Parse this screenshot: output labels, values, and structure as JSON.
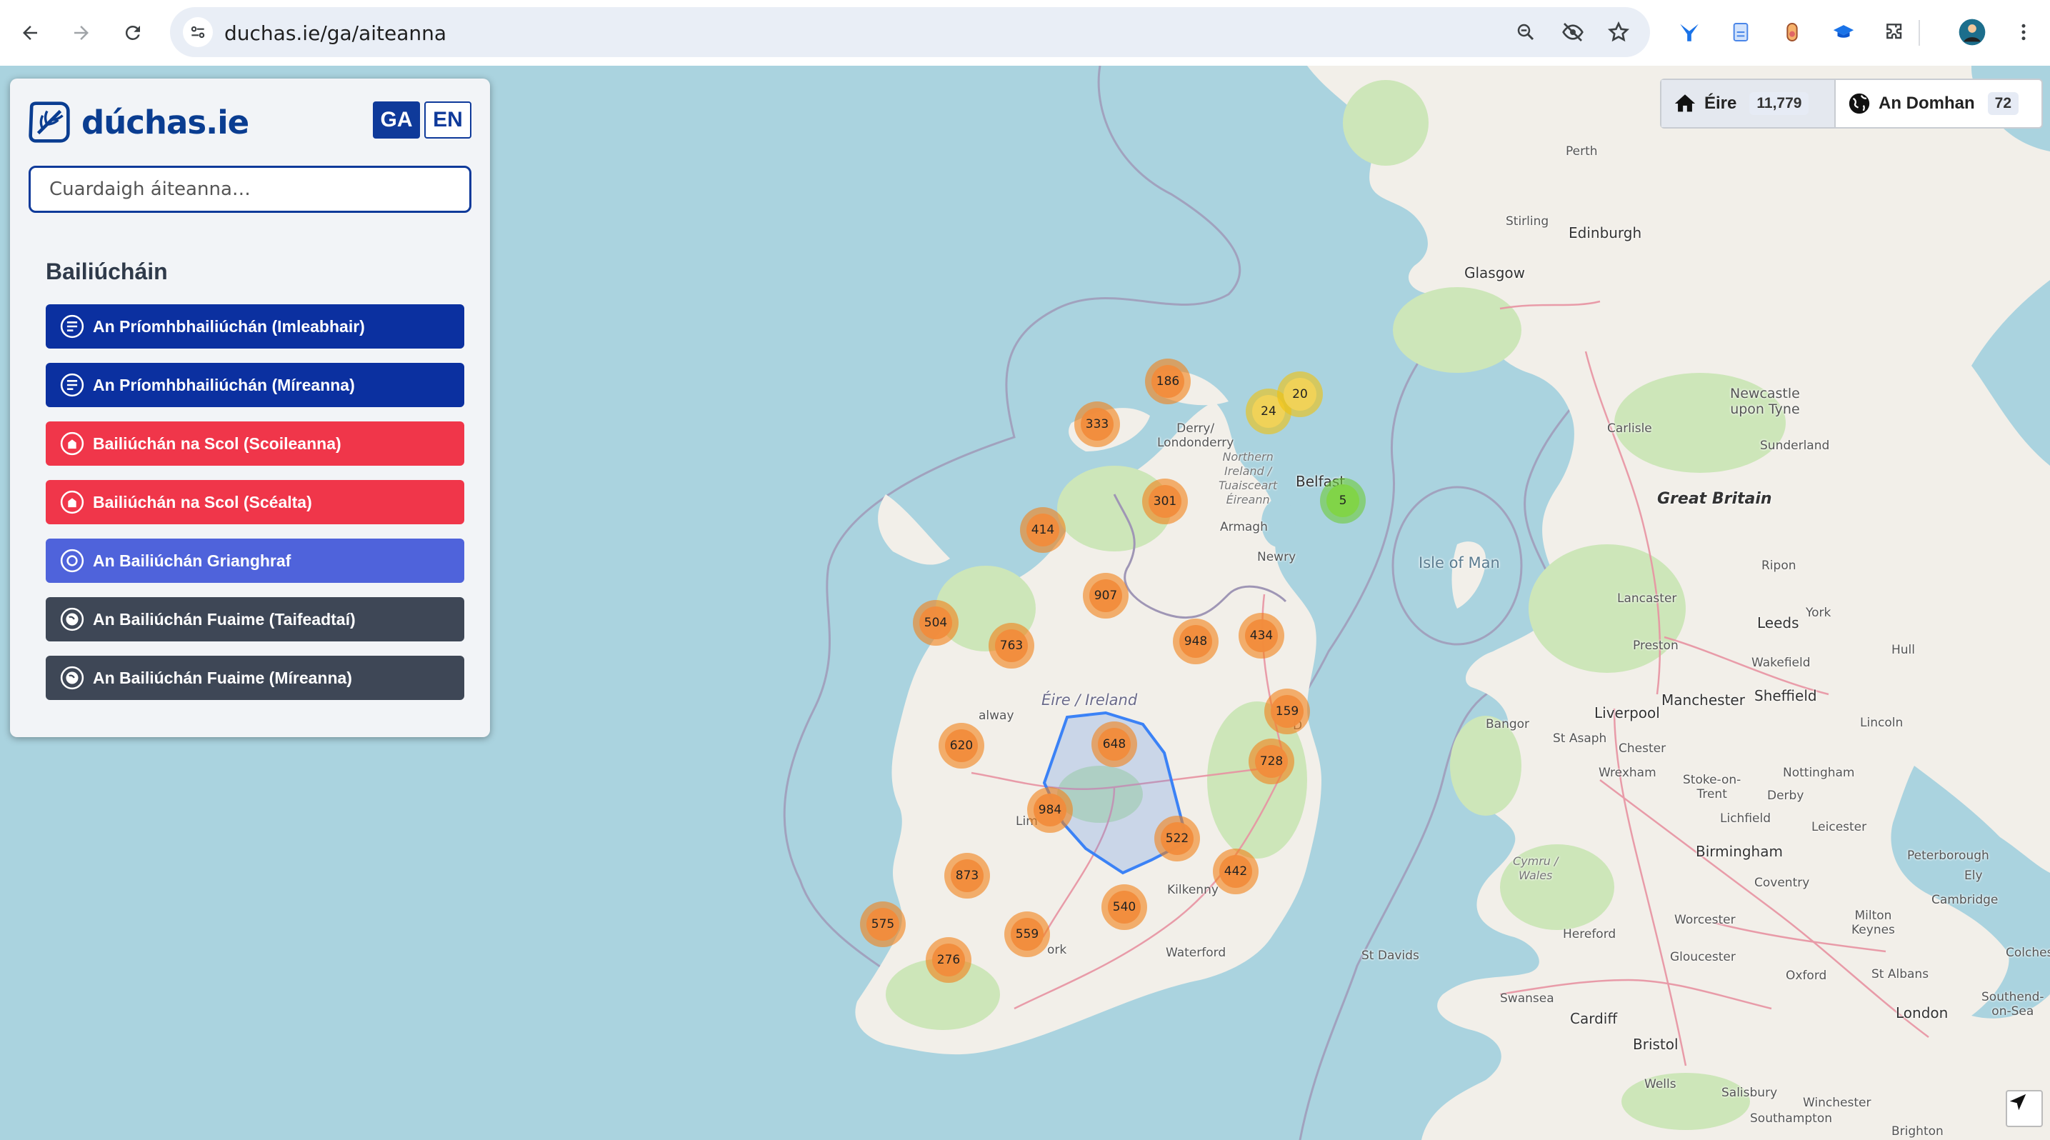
{
  "browser": {
    "url": "duchas.ie/ga/aiteanna",
    "icons": [
      "back-arrow-icon",
      "forward-arrow-icon",
      "reload-icon",
      "site-settings-icon",
      "zoom-icon",
      "eye-off-icon",
      "star-icon",
      "extension-y-icon",
      "extension-doc-icon",
      "extension-flask-icon",
      "extension-cap-icon",
      "puzzle-icon",
      "profile-avatar",
      "more-vert-icon"
    ]
  },
  "sidebar": {
    "brand": "dúchas.ie",
    "lang_ga": "GA",
    "lang_en": "EN",
    "search_placeholder": "Cuardaigh áiteanna…",
    "section_title": "Bailiúcháin",
    "collections": [
      {
        "label": "An Príomhbhailiúchán (Imleabhair)",
        "color": "#0b30a0",
        "icon": "document-lines-icon"
      },
      {
        "label": "An Príomhbhailiúchán (Míreanna)",
        "color": "#0b30a0",
        "icon": "document-lines-icon"
      },
      {
        "label": "Bailiúchán na Scol (Scoileanna)",
        "color": "#f0364a",
        "icon": "school-icon"
      },
      {
        "label": "Bailiúchán na Scol (Scéalta)",
        "color": "#f0364a",
        "icon": "school-icon"
      },
      {
        "label": "An Bailiúchán Grianghraf",
        "color": "#4f63db",
        "icon": "camera-lens-icon"
      },
      {
        "label": "An Bailiúchán Fuaime (Taifeadtaí)",
        "color": "#3e4756",
        "icon": "audio-globe-icon"
      },
      {
        "label": "An Bailiúchán Fuaime (Míreanna)",
        "color": "#3e4756",
        "icon": "audio-globe-icon"
      }
    ]
  },
  "switcher": {
    "eire_label": "Éire",
    "eire_count": "11,779",
    "world_label": "An Domhan",
    "world_count": "72"
  },
  "map": {
    "places": {
      "perth": "Perth",
      "stirling": "Stirling",
      "edinburgh": "Edinburgh",
      "glasgow": "Glasgow",
      "derry": "Derry/\nLondonderry",
      "ni": "Northern\nIreland /\nTuaisceart\nÉireann",
      "belfast": "Belfast",
      "armagh": "Armagh",
      "newry": "Newry",
      "isle_of_man": "Isle of Man",
      "newcastle": "Newcastle\nupon Tyne",
      "carlisle": "Carlisle",
      "sunderland": "Sunderland",
      "great_britain": "Great Britain",
      "ripon": "Ripon",
      "lancaster": "Lancaster",
      "york": "York",
      "leeds": "Leeds",
      "preston": "Preston",
      "hull": "Hull",
      "wakefield": "Wakefield",
      "manchester": "Manchester",
      "sheffield": "Sheffield",
      "liverpool": "Liverpool",
      "bangor": "Bangor",
      "st_asaph": "St Asaph",
      "chester": "Chester",
      "lincoln": "Lincoln",
      "wrexham": "Wrexham",
      "stoke": "Stoke-on-\nTrent",
      "nottingham": "Nottingham",
      "derby": "Derby",
      "lichfield": "Lichfield",
      "leicester": "Leicester",
      "cymru": "Cymru /\nWales",
      "birmingham": "Birmingham",
      "peterborough": "Peterborough",
      "ely": "Ely",
      "coventry": "Coventry",
      "cambridge": "Cambridge",
      "hereford": "Hereford",
      "worcester": "Worcester",
      "milton_keynes": "Milton\nKeynes",
      "colchester": "Colchester",
      "st_davids": "St Davids",
      "gloucester": "Gloucester",
      "oxford": "Oxford",
      "st_albans": "St Albans",
      "swansea": "Swansea",
      "cardiff": "Cardiff",
      "london": "London",
      "southend": "Southend-\non-Sea",
      "bristol": "Bristol",
      "wells": "Wells",
      "salisbury": "Salisbury",
      "winchester": "Winchester",
      "southampton": "Southampton",
      "brighton": "Brighton",
      "eire": "Éire / Ireland",
      "galway": "alway",
      "waterford": "Waterford",
      "cork": "ork",
      "limerick": "Lim",
      "kilkenny": "Kilkenny",
      "dublin": "D"
    },
    "clusters": [
      {
        "id": "c186",
        "value": "186",
        "level": "orange"
      },
      {
        "id": "c333",
        "value": "333",
        "level": "orange"
      },
      {
        "id": "c24",
        "value": "24",
        "level": "yellow"
      },
      {
        "id": "c20",
        "value": "20",
        "level": "yellow"
      },
      {
        "id": "c5",
        "value": "5",
        "level": "green"
      },
      {
        "id": "c301",
        "value": "301",
        "level": "orange"
      },
      {
        "id": "c414",
        "value": "414",
        "level": "orange"
      },
      {
        "id": "c907",
        "value": "907",
        "level": "orange"
      },
      {
        "id": "c504",
        "value": "504",
        "level": "orange"
      },
      {
        "id": "c434",
        "value": "434",
        "level": "orange"
      },
      {
        "id": "c763",
        "value": "763",
        "level": "orange"
      },
      {
        "id": "c948",
        "value": "948",
        "level": "orange"
      },
      {
        "id": "c159",
        "value": "159",
        "level": "orange"
      },
      {
        "id": "c648",
        "value": "648",
        "level": "orange"
      },
      {
        "id": "c620",
        "value": "620",
        "level": "orange"
      },
      {
        "id": "c728",
        "value": "728",
        "level": "orange"
      },
      {
        "id": "c984",
        "value": "984",
        "level": "orange"
      },
      {
        "id": "c522",
        "value": "522",
        "level": "orange"
      },
      {
        "id": "c873",
        "value": "873",
        "level": "orange"
      },
      {
        "id": "c442",
        "value": "442",
        "level": "orange"
      },
      {
        "id": "c540",
        "value": "540",
        "level": "orange"
      },
      {
        "id": "c575",
        "value": "575",
        "level": "orange"
      },
      {
        "id": "c559",
        "value": "559",
        "level": "orange"
      },
      {
        "id": "c276",
        "value": "276",
        "level": "orange"
      }
    ]
  }
}
